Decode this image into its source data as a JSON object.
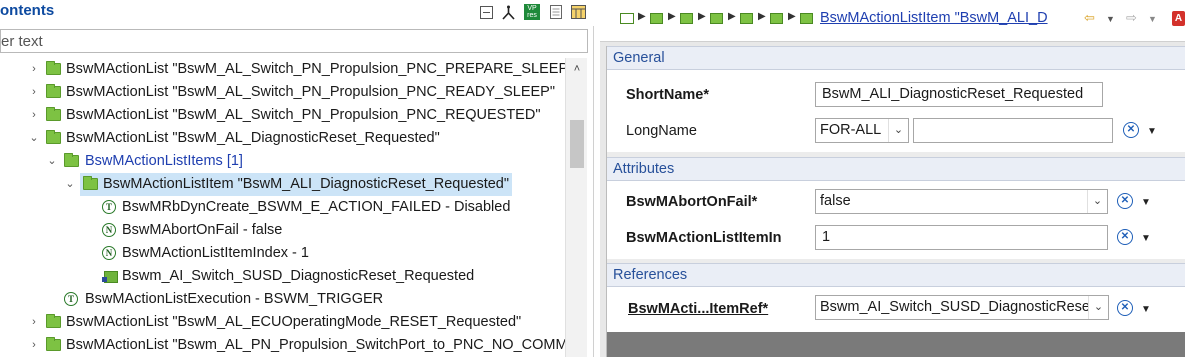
{
  "left": {
    "title": "ontents",
    "filter": {
      "placeholder": "er text",
      "value": ""
    },
    "toolbar": {
      "collapse_icon": "collapse-all-icon",
      "link_icon": "link-with-editor-icon",
      "vp_label": "VP\nres",
      "doc_icon": "document-icon",
      "grid_icon": "layout-icon"
    },
    "tree": [
      {
        "twisty": "›",
        "icon": "folder",
        "text": "BswMActionList \"BswM_AL_Switch_PN_Propulsion_PNC_PREPARE_SLEEP\""
      },
      {
        "twisty": "›",
        "icon": "folder",
        "text": "BswMActionList \"BswM_AL_Switch_PN_Propulsion_PNC_READY_SLEEP\""
      },
      {
        "twisty": "›",
        "icon": "folder",
        "text": "BswMActionList \"BswM_AL_Switch_PN_Propulsion_PNC_REQUESTED\""
      },
      {
        "twisty": "⌄",
        "icon": "folder",
        "text": "BswMActionList \"BswM_AL_DiagnosticReset_Requested\""
      },
      {
        "twisty": "⌄",
        "icon": "folder",
        "text": "BswMActionListItems [1]"
      },
      {
        "twisty": "⌄",
        "icon": "folder",
        "text": "BswMActionListItem \"BswM_ALI_DiagnosticReset_Requested\""
      },
      {
        "twisty": "",
        "icon": "T",
        "text": "BswMRbDynCreate_BSWM_E_ACTION_FAILED - Disabled"
      },
      {
        "twisty": "",
        "icon": "N",
        "text": "BswMAbortOnFail - false"
      },
      {
        "twisty": "",
        "icon": "N",
        "text": "BswMActionListItemIndex - 1"
      },
      {
        "twisty": "",
        "icon": "ref",
        "text": "Bswm_AI_Switch_SUSD_DiagnosticReset_Requested"
      },
      {
        "twisty": "",
        "icon": "T",
        "text": "BswMActionListExecution - BSWM_TRIGGER"
      },
      {
        "twisty": "›",
        "icon": "folder",
        "text": "BswMActionList \"BswM_AL_ECUOperatingMode_RESET_Requested\""
      },
      {
        "twisty": "›",
        "icon": "folder",
        "text": "BswMActionList \"Bswm_AL_PN_Propulsion_SwitchPort_to_PNC_NO_COMMUN"
      }
    ]
  },
  "right": {
    "breadcrumb_link": "BswMActionListItem \"BswM_ALI_D",
    "nav_red_label": "A",
    "sections": {
      "general": "General",
      "attributes": "Attributes",
      "references": "References"
    },
    "fields": {
      "shortname_label": "ShortName*",
      "shortname_value": "BswM_ALI_DiagnosticReset_Requested",
      "longname_label": "LongName",
      "longname_lang": "FOR-ALL",
      "longname_value": "",
      "abort_label": "BswMAbortOnFail*",
      "abort_value": "false",
      "index_label": "BswMActionListItemIn",
      "index_value": "1",
      "ref_label": "BswMActi...ItemRef*",
      "ref_value": "Bswm_AI_Switch_SUSD_DiagnosticReset"
    }
  }
}
